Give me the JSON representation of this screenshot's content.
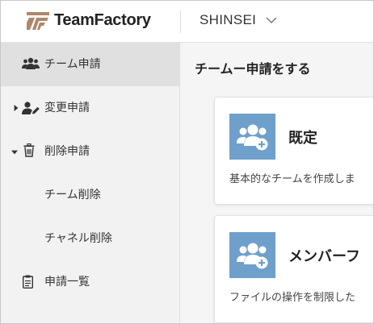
{
  "app": {
    "brand": "TeamFactory",
    "workspace": "SHINSEI"
  },
  "sidebar": {
    "items": [
      {
        "label": "チーム申請",
        "icon": "users-icon",
        "active": true
      },
      {
        "label": "変更申請",
        "icon": "user-edit-icon",
        "caret": "right"
      },
      {
        "label": "削除申請",
        "icon": "trash-icon",
        "caret": "down"
      },
      {
        "label": "チーム削除"
      },
      {
        "label": "チャネル削除"
      },
      {
        "label": "申請一覧",
        "icon": "clipboard-icon"
      }
    ]
  },
  "main": {
    "title": "チームー申請をする",
    "cards": [
      {
        "title": "既定",
        "description": "基本的なチームを作成しま",
        "icon": "users-add-icon"
      },
      {
        "title": "メンバーフ",
        "description": "ファイルの操作を制限した",
        "icon": "users-add-icon"
      }
    ]
  },
  "colors": {
    "accent": "#6f9fcb",
    "sidebar_bg": "#f2f2f2",
    "sidebar_active": "#e0e0e0",
    "logo": "#b0866a"
  }
}
